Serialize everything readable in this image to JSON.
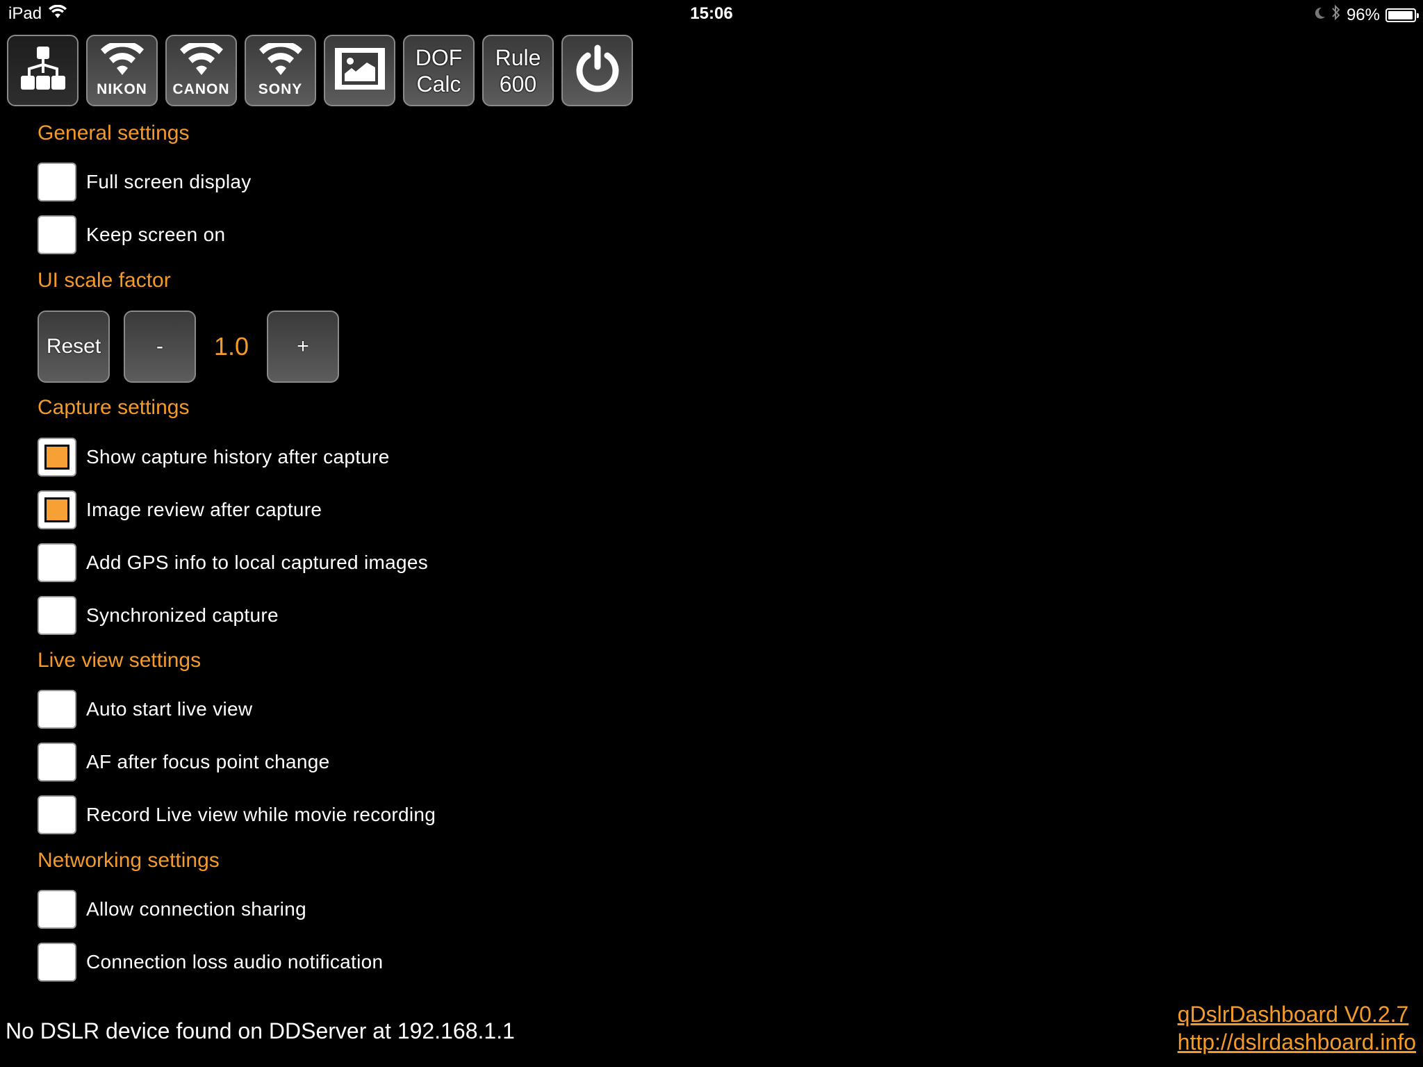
{
  "status_bar": {
    "device": "iPad",
    "time": "15:06",
    "battery_percent": "96%",
    "battery_level": 0.96,
    "icons": [
      "wifi-icon",
      "moon-icon",
      "bluetooth-icon",
      "battery-icon"
    ]
  },
  "toolbar": {
    "buttons": [
      {
        "name": "network-button",
        "icon": "network-tree-icon",
        "selected": true
      },
      {
        "name": "nikon-wifi-button",
        "icon": "wifi-icon",
        "label": "NIKON"
      },
      {
        "name": "canon-wifi-button",
        "icon": "wifi-icon",
        "label": "CANON"
      },
      {
        "name": "sony-wifi-button",
        "icon": "wifi-icon",
        "label": "SONY"
      },
      {
        "name": "gallery-button",
        "icon": "image-icon"
      },
      {
        "name": "dof-calc-button",
        "line1": "DOF",
        "line2": "Calc"
      },
      {
        "name": "rule-600-button",
        "line1": "Rule",
        "line2": "600"
      },
      {
        "name": "power-button",
        "icon": "power-icon"
      }
    ]
  },
  "sections": {
    "general": {
      "title": "General settings",
      "items": [
        {
          "label": "Full screen display",
          "checked": false
        },
        {
          "label": "Keep screen on",
          "checked": false
        }
      ]
    },
    "ui_scale": {
      "title": "UI scale factor",
      "reset_label": "Reset",
      "minus_label": "-",
      "value": "1.0",
      "plus_label": "+"
    },
    "capture": {
      "title": "Capture settings",
      "items": [
        {
          "label": "Show capture history after capture",
          "checked": true
        },
        {
          "label": "Image review after capture",
          "checked": true
        },
        {
          "label": "Add GPS info to local captured images",
          "checked": false
        },
        {
          "label": "Synchronized capture",
          "checked": false
        }
      ]
    },
    "live_view": {
      "title": "Live view settings",
      "items": [
        {
          "label": "Auto start live view",
          "checked": false
        },
        {
          "label": "AF after focus point change",
          "checked": false
        },
        {
          "label": "Record Live view while movie recording",
          "checked": false
        }
      ]
    },
    "networking": {
      "title": "Networking settings",
      "items": [
        {
          "label": "Allow connection sharing",
          "checked": false
        },
        {
          "label": "Connection loss audio notification",
          "checked": false
        }
      ]
    }
  },
  "footer": {
    "status": "No DSLR device found on DDServer at 192.168.1.1",
    "version_link": "qDslrDashboard V0.2.7",
    "site_link": "http://dslrdashboard.info"
  },
  "colors": {
    "accent": "#f39a2b",
    "checkbox_fill": "#f7a035",
    "background": "#000000"
  }
}
